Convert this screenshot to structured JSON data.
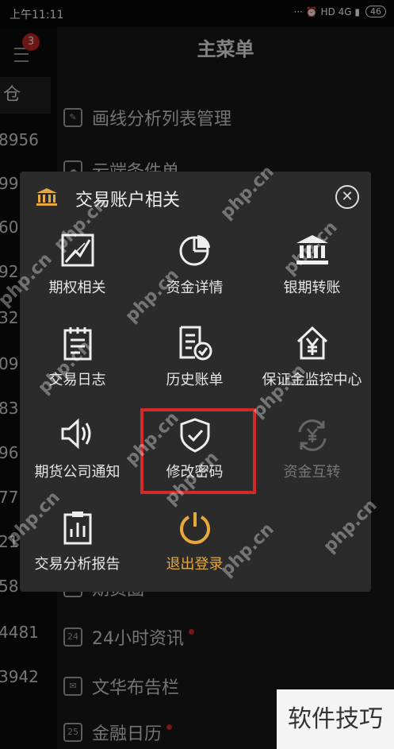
{
  "status": {
    "time": "上午11:11",
    "icons": "··· ⏰ HD 4G ▮",
    "battery": "46"
  },
  "notify": {
    "count": "3"
  },
  "left_tab": "仓",
  "left_numbers": [
    "8956",
    "99",
    "60",
    "92",
    "32",
    "09",
    "83",
    "96",
    "77",
    "21",
    "58",
    "4481",
    "3942"
  ],
  "main": {
    "title": "主菜单",
    "rows": [
      {
        "label": "画线分析列表管理",
        "icon": "chart-icon",
        "dot": false
      },
      {
        "label": "云端条件单",
        "icon": "cloud-icon",
        "dot": false
      },
      {
        "label": "期货圈",
        "icon": "circle-icon",
        "dot": false
      },
      {
        "label": "24小时资讯",
        "icon": "24h-icon",
        "dot": true
      },
      {
        "label": "文华布告栏",
        "icon": "mail-icon",
        "dot": false
      },
      {
        "label": "金融日历",
        "icon": "calendar-icon",
        "dot": true
      }
    ]
  },
  "dialog": {
    "title": "交易账户相关",
    "items": [
      {
        "label": "期权相关",
        "icon": "options-chart-icon"
      },
      {
        "label": "资金详情",
        "icon": "pie-chart-icon"
      },
      {
        "label": "银期转账",
        "icon": "bank-icon"
      },
      {
        "label": "交易日志",
        "icon": "notepad-icon"
      },
      {
        "label": "历史账单",
        "icon": "bill-check-icon"
      },
      {
        "label": "保证金监控中心",
        "icon": "yen-house-icon"
      },
      {
        "label": "期货公司通知",
        "icon": "speaker-icon"
      },
      {
        "label": "修改密码",
        "icon": "shield-check-icon"
      },
      {
        "label": "资金互转",
        "icon": "yen-exchange-icon"
      },
      {
        "label": "交易分析报告",
        "icon": "report-icon"
      },
      {
        "label": "退出登录",
        "icon": "power-icon"
      }
    ]
  },
  "watermark": "php.cn",
  "corner_text": "软件技巧",
  "colors": {
    "accent_gold": "#e6a93a",
    "highlight_red": "#d02a2a",
    "badge_red": "#c62828"
  }
}
